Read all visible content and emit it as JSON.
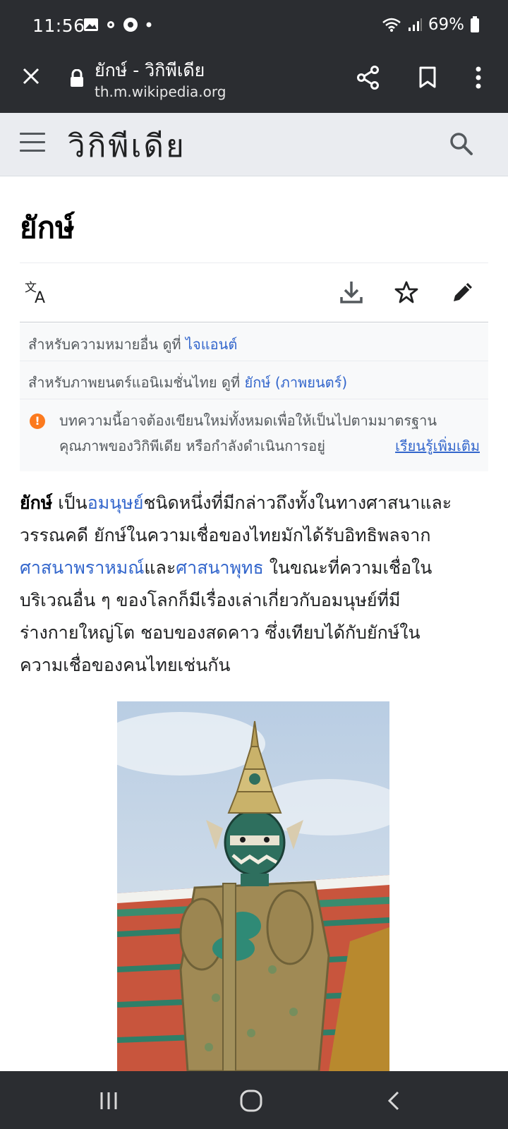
{
  "status": {
    "time": "11:56",
    "battery": "69%"
  },
  "browser": {
    "tab_title": "ยักษ์ - วิกิพีเดีย",
    "url": "th.m.wikipedia.org"
  },
  "header": {
    "wordmark": "วิกิพีเดีย"
  },
  "article": {
    "title": "ยักษ์",
    "hatnotes": [
      {
        "text": "สำหรับความหมายอื่น ดูที่ ",
        "link": "ไจแอนต์"
      },
      {
        "text": "สำหรับภาพยนตร์แอนิเมชั่นไทย ดูที่ ",
        "link": "ยักษ์ (ภาพยนตร์)"
      }
    ],
    "issue": {
      "line1": "บทความนี้อาจต้องเขียนใหม่ทั้งหมดเพื่อให้เป็นไปตามมาตรฐาน",
      "line2": "คุณภาพของวิกิพีเดีย หรือกำลังดำเนินการอยู่",
      "learn_more": "เรียนรู้เพิ่มเติม"
    },
    "intro": {
      "bold": "ยักษ์",
      "t1": " เป็น",
      "link1": "อมนุษย์",
      "t2": "ชนิดหนึ่งที่มีกล่าวถึงทั้งในทางศาสนาและ",
      "line2": "วรรณคดี ยักษ์ในความเชื่อของไทยมักได้รับอิทธิพลจาก",
      "link2": "ศาสนาพราหมณ์",
      "t3": "และ",
      "link3": "ศาสนาพุทธ",
      "t4": " ในขณะที่ความเชื่อใน",
      "line4": "บริเวณอื่น ๆ ของโลกก็มีเรื่องเล่าเกี่ยวกับอมนุษย์ที่มี",
      "line5": "ร่างกายใหญ่โต ชอบของสดคาว ซึ่งเทียบได้กับยักษ์ใน",
      "line6": "ความเชื่อของคนไทยเช่นกัน"
    }
  },
  "colors": {
    "link": "#3366cc",
    "chrome": "#2b2d31",
    "header_bg": "#eaecf0",
    "warning": "#fc7a1e"
  }
}
